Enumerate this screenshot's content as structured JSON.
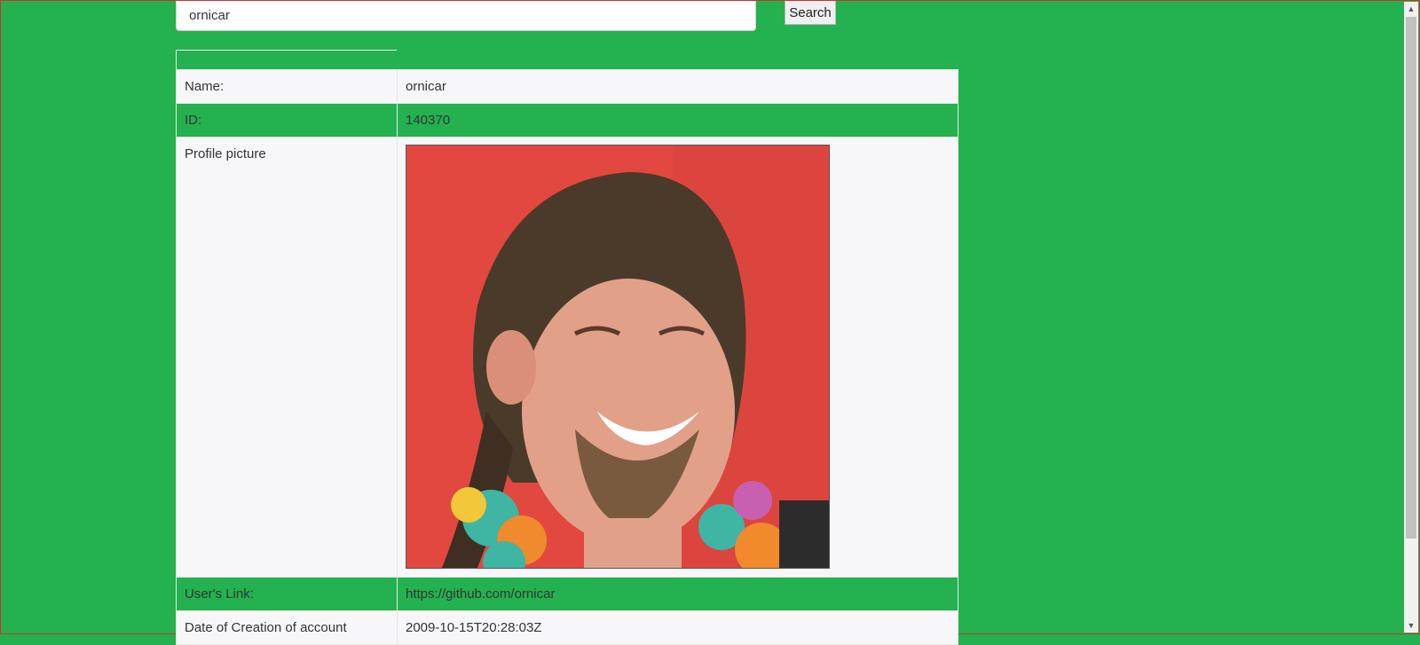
{
  "search": {
    "value": "ornicar",
    "button_label": "Search"
  },
  "profile": {
    "name_label": "Name:",
    "name_value": "ornicar",
    "id_label": "ID:",
    "id_value": "140370",
    "picture_label": "Profile picture",
    "link_label": "User's Link:",
    "link_value": "https://github.com/ornicar",
    "created_label": "Date of Creation of account",
    "created_value": "2009-10-15T20:28:03Z"
  },
  "colors": {
    "background": "#24b14f",
    "row_light": "#f7f7f9",
    "border": "#d0312d"
  },
  "scrollbar": {
    "up_icon": "scroll-up-arrow",
    "down_icon": "scroll-down-arrow"
  }
}
